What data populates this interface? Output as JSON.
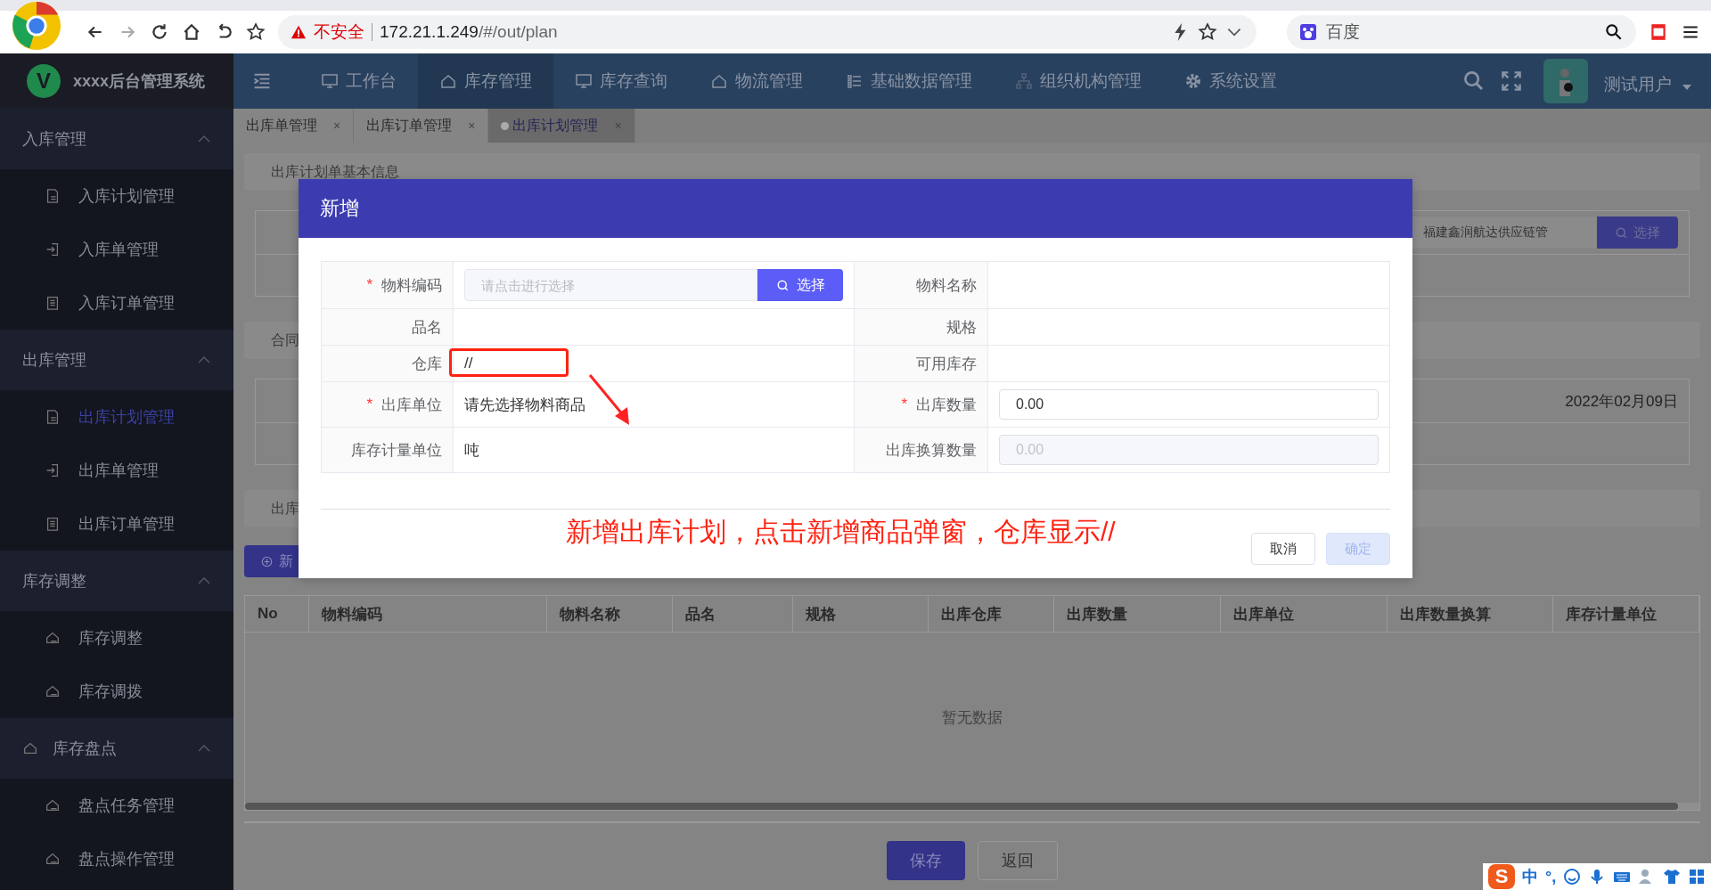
{
  "browser": {
    "security": "不安全",
    "host": "172.21.1.249",
    "path": "/#/out/plan",
    "search_placeholder": "百度"
  },
  "app": {
    "title": "xxxx后台管理系统",
    "logo_letter": "V",
    "user": "测试用户"
  },
  "nav": [
    {
      "label": "工作台",
      "selected": false,
      "kind": "monitor"
    },
    {
      "label": "库存管理",
      "selected": true,
      "kind": "home"
    },
    {
      "label": "库存查询",
      "selected": false,
      "kind": "screen"
    },
    {
      "label": "物流管理",
      "selected": false,
      "kind": "home"
    },
    {
      "label": "基础数据管理",
      "selected": false,
      "kind": "list"
    },
    {
      "label": "组织机构管理",
      "selected": false,
      "kind": "org"
    },
    {
      "label": "系统设置",
      "selected": false,
      "kind": "gear"
    }
  ],
  "sidebar": {
    "groups": [
      {
        "label": "入库管理",
        "kind": "plain",
        "expanded": true,
        "items": [
          {
            "label": "入库计划管理",
            "selected": false,
            "kind": "doc"
          },
          {
            "label": "入库单管理",
            "selected": false,
            "kind": "enter"
          },
          {
            "label": "入库订单管理",
            "selected": false,
            "kind": "clipboard"
          }
        ]
      },
      {
        "label": "出库管理",
        "kind": "plain",
        "expanded": true,
        "items": [
          {
            "label": "出库计划管理",
            "selected": true,
            "kind": "doc"
          },
          {
            "label": "出库单管理",
            "selected": false,
            "kind": "enter"
          },
          {
            "label": "出库订单管理",
            "selected": false,
            "kind": "clipboard"
          }
        ]
      },
      {
        "label": "库存调整",
        "kind": "plain",
        "expanded": true,
        "items": [
          {
            "label": "库存调整",
            "selected": false,
            "kind": "home"
          },
          {
            "label": "库存调拨",
            "selected": false,
            "kind": "home"
          }
        ]
      },
      {
        "label": "库存盘点",
        "kind": "icon",
        "expanded": true,
        "items": [
          {
            "label": "盘点任务管理",
            "selected": false,
            "kind": "home"
          },
          {
            "label": "盘点操作管理",
            "selected": false,
            "kind": "home"
          }
        ]
      }
    ]
  },
  "tabs": [
    {
      "label": "出库单管理",
      "selected": false,
      "close": "×"
    },
    {
      "label": "出库订单管理",
      "selected": false,
      "close": "×"
    },
    {
      "label": "出库计划管理",
      "selected": true,
      "close": "×"
    }
  ],
  "page": {
    "section_1": "出库计划单基本信息",
    "supplier_value": "福建鑫润航达供应链管",
    "supplier_button": "选择",
    "section_2": "合同",
    "date": "2022年02月09日",
    "section_3": "出库",
    "add_button": "新",
    "table": {
      "columns": [
        "No",
        "物料编码",
        "物料名称",
        "品名",
        "规格",
        "出库仓库",
        "出库数量",
        "出库单位",
        "出库数量换算",
        "库存计量单位"
      ],
      "empty": "暂无数据"
    },
    "buttons": [
      {
        "label": "保存",
        "kind": "primary"
      },
      {
        "label": "返回",
        "kind": "plain"
      }
    ]
  },
  "dialog": {
    "title": "新增",
    "rows": [
      [
        {
          "label": "物料编码",
          "required_mark": "*",
          "highlighted": false,
          "kind": "picker",
          "placeholder": "请点击进行选择",
          "button": "选择"
        },
        {
          "label": "物料名称",
          "highlighted": false,
          "kind": "text"
        }
      ],
      [
        {
          "label": "品名",
          "highlighted": false,
          "kind": "text"
        },
        {
          "label": "规格",
          "highlighted": false,
          "kind": "text"
        }
      ],
      [
        {
          "label": "仓库",
          "highlighted": true,
          "kind": "text",
          "value": "//"
        },
        {
          "label": "可用库存",
          "highlighted": false,
          "kind": "text"
        }
      ],
      [
        {
          "label": "出库单位",
          "required_mark": "*",
          "highlighted": false,
          "kind": "text",
          "value": "请先选择物料商品"
        },
        {
          "label": "出库数量",
          "required_mark": "*",
          "highlighted": false,
          "kind": "input",
          "value": "0.00",
          "disabled": false
        }
      ],
      [
        {
          "label": "库存计量单位",
          "highlighted": false,
          "kind": "text",
          "value": "吨"
        },
        {
          "label": "出库换算数量",
          "highlighted": false,
          "kind": "input",
          "value": "0.00",
          "disabled": true
        }
      ]
    ],
    "annotation": "新增出库计划，点击新增商品弹窗，仓库显示//",
    "buttons": [
      {
        "label": "取消",
        "disabled": false,
        "kind": "plain"
      },
      {
        "label": "确定",
        "disabled": true,
        "kind": "primary"
      }
    ]
  },
  "ime": {
    "logo": "S",
    "mode": "中",
    "punct": "°,"
  }
}
